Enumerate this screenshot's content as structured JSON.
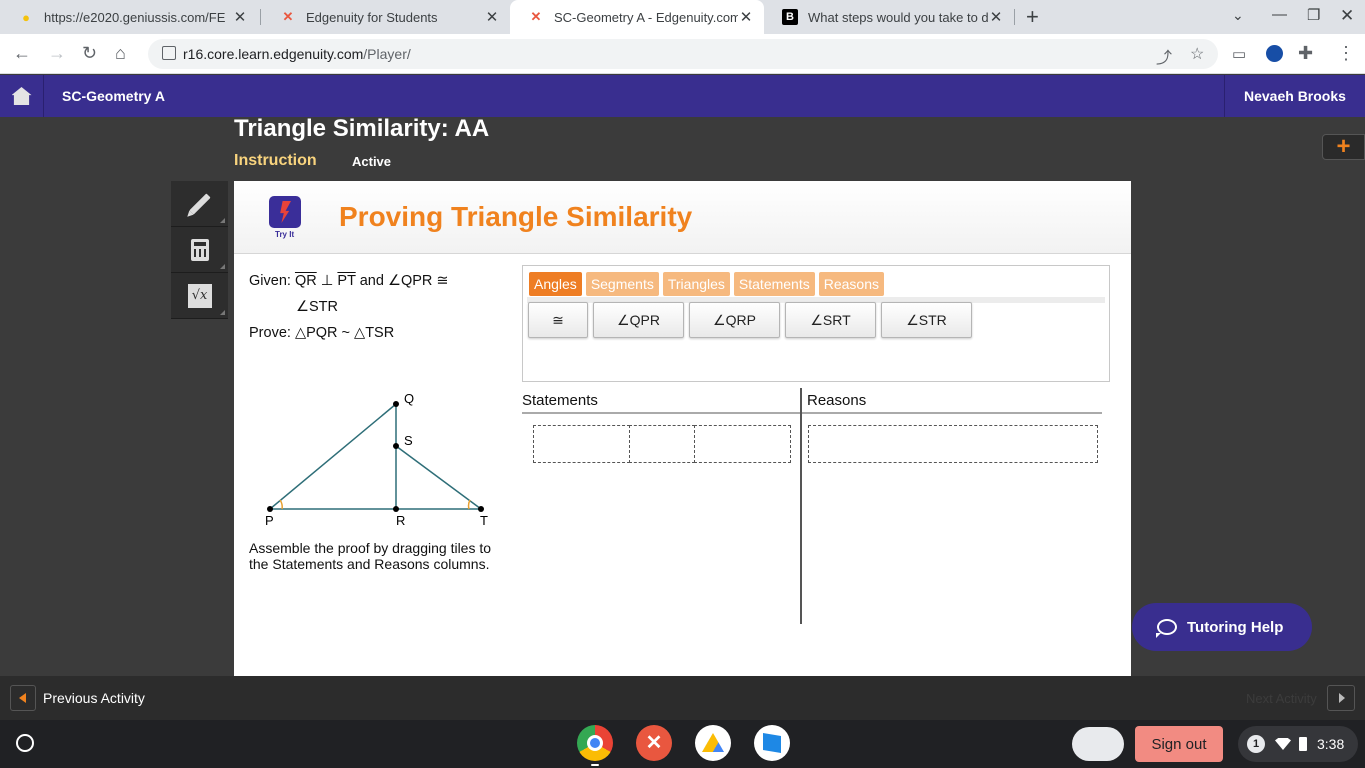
{
  "browser": {
    "tabs": [
      {
        "title": "https://e2020.geniussis.com/FE",
        "active": false
      },
      {
        "title": "Edgenuity for Students",
        "active": false
      },
      {
        "title": "SC-Geometry A - Edgenuity.com",
        "active": true
      },
      {
        "title": "What steps would you take to de",
        "active": false
      }
    ],
    "url_host": "r16.core.learn.edgenuity.com",
    "url_path": "/Player/"
  },
  "header": {
    "course": "SC-Geometry A",
    "user": "Nevaeh Brooks"
  },
  "lesson": {
    "title": "Triangle Similarity: AA",
    "tab_instruction": "Instruction",
    "tab_active": "Active"
  },
  "activity": {
    "try_it_label": "Try It",
    "title": "Proving Triangle Similarity",
    "given_label": "Given:",
    "given_seg1": "QR",
    "perp": "⊥",
    "given_seg2": "PT",
    "given_and": "and",
    "given_angle": "∠QPR ≅",
    "given_angle2": "∠STR",
    "prove_label": "Prove:",
    "prove_text": "△PQR ~ △TSR",
    "instructions": "Assemble the proof by dragging tiles to the Statements and Reasons columns.",
    "diagram_points": [
      "P",
      "Q",
      "R",
      "S",
      "T"
    ],
    "tile_tabs": [
      "Angles",
      "Segments",
      "Triangles",
      "Statements",
      "Reasons"
    ],
    "tiles": [
      "≅",
      "∠QPR",
      "∠QRP",
      "∠SRT",
      "∠STR"
    ],
    "statements_header": "Statements",
    "reasons_header": "Reasons"
  },
  "tutoring": {
    "label": "Tutoring Help"
  },
  "nav": {
    "previous": "Previous Activity",
    "next": "Next Activity"
  },
  "shelf": {
    "sign_out": "Sign out",
    "notifications": "1",
    "time": "3:38"
  },
  "colors": {
    "header_purple": "#392e8f",
    "accent_orange": "#f0821e"
  }
}
